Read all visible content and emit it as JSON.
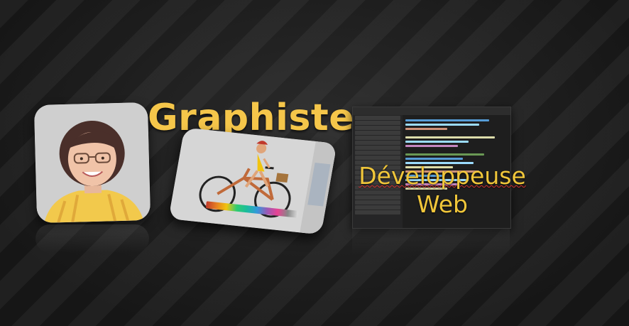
{
  "title_graphiste": "Graphiste",
  "title_dev_line1": "Développeuse",
  "title_dev_line2": "Web",
  "colors": {
    "title": "#f5c64a",
    "background": "#1c1c1c",
    "spellcheck": "#d03030"
  },
  "images": {
    "portrait": "person-portrait",
    "illustration": "cyclist-illustration",
    "code_editor": "code-editor-screenshot"
  }
}
